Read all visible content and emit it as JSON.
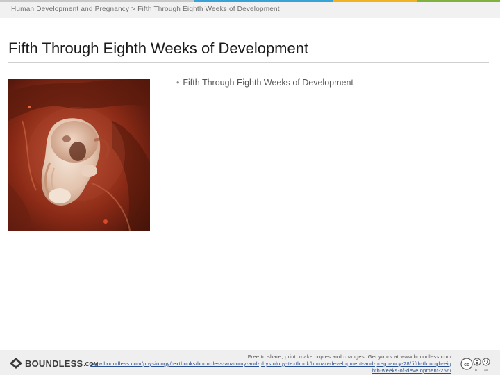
{
  "header": {
    "breadcrumb": "Human Development and Pregnancy > Fifth Through Eighth Weeks of Development",
    "accent_colors": [
      "#c9c9c9",
      "#39a3d8",
      "#f0b323",
      "#7fb241"
    ]
  },
  "slide": {
    "title": "Fifth Through Eighth Weeks of Development",
    "bullets": [
      "Fifth Through Eighth Weeks of Development"
    ],
    "image": {
      "subject": "embryo-photo",
      "colors": [
        "#5a1a0c",
        "#b8452a",
        "#e8cdbb",
        "#f3e4d6"
      ]
    }
  },
  "footer": {
    "logo_text": "BOUNDLESS",
    "logo_suffix": ".COM",
    "share_text": "Free to share, print, make copies and changes. Get yours at www.boundless.com",
    "url": "www.boundless.com/physiology/textbooks/boundless-anatomy-and-physiology-textbook/human-development-and-pregnancy-28/fifth-through-eighth-weeks-of-development-256/",
    "license_icon": "cc-by-sa-icon",
    "license_labels": [
      "BY",
      "SA"
    ]
  }
}
